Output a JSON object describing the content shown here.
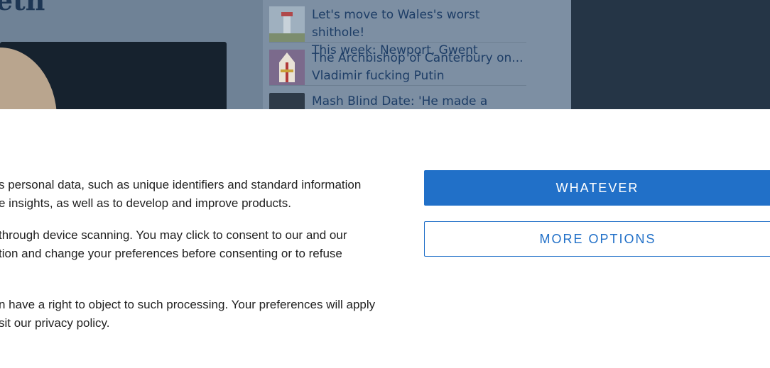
{
  "background": {
    "title_fragment": "eth",
    "stories": [
      {
        "text": "Let's move to Wales's worst shithole!\nThis week: Newport, Gwent",
        "thumb_color": "#9fb0bf"
      },
      {
        "text": "The Archbishop of Canterbury on...\nVladimir fucking Putin",
        "thumb_color": "#7b6a8c"
      },
      {
        "text": "Mash Blind Date: 'He made a woman",
        "thumb_color": "#2e3a48"
      }
    ]
  },
  "consent": {
    "paragraph1": "s personal data, such as unique identifiers and standard information\ne insights, as well as to develop and improve products.",
    "paragraph2": "through device scanning. You may click to consent to our and our\ntion and change your preferences before consenting or to refuse",
    "paragraph3": "n have a right to object to such processing. Your preferences will apply\nsit our privacy policy.",
    "accept_label": "WHATEVER",
    "more_label": "MORE OPTIONS"
  },
  "colors": {
    "accent": "#2170c8"
  }
}
